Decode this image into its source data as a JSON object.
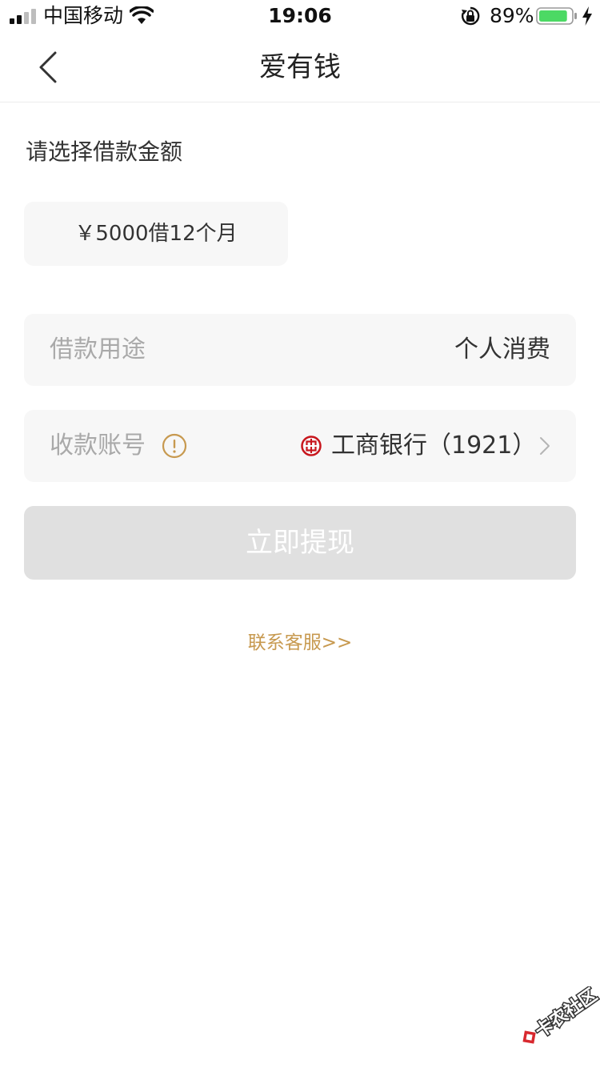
{
  "status_bar": {
    "carrier": "中国移动",
    "time": "19:06",
    "battery_percent": "89%",
    "battery_level": 0.89,
    "icons": [
      "signal-icon",
      "wifi-icon",
      "rotation-lock-icon",
      "battery-icon",
      "charging-icon"
    ]
  },
  "nav": {
    "title": "爱有钱",
    "back_icon": "chevron-left-icon"
  },
  "loan": {
    "section_label": "请选择借款金额",
    "amount_option": "￥5000借12个月"
  },
  "purpose": {
    "label": "借款用途",
    "value": "个人消费"
  },
  "account": {
    "label": "收款账号",
    "info_icon": "info-icon",
    "bank_icon": "icbc-bank-icon",
    "bank": "工商银行（1921）",
    "arrow_icon": "chevron-right-icon"
  },
  "actions": {
    "withdraw_label": "立即提现",
    "service_link": "联系客服>>"
  },
  "colors": {
    "accent": "#c7994f",
    "button_disabled": "#e0e0e0",
    "card_bg": "#f7f7f7",
    "bank_red": "#c8161d",
    "battery_green": "#4cd964"
  },
  "watermark": {
    "text": "卡农社区"
  }
}
